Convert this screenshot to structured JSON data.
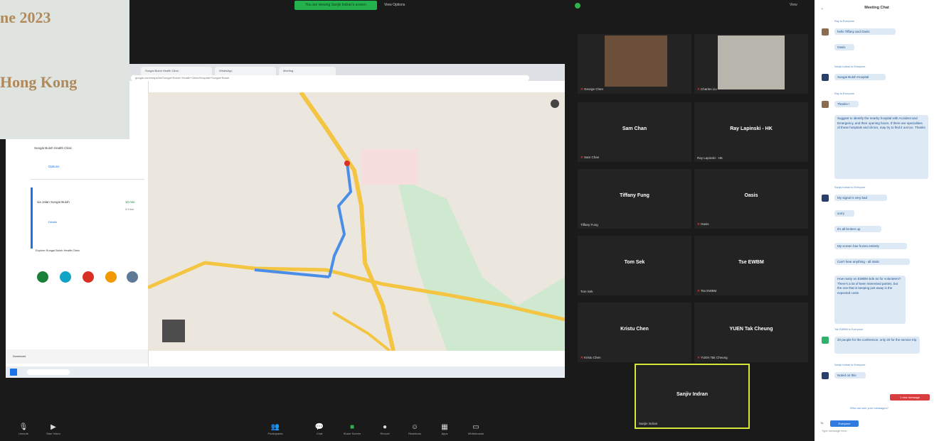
{
  "caption": {
    "line1": "ne 2023",
    "line2": "Hong Kong"
  },
  "top": {
    "share_banner": "You are viewing Sanjiv Indran's screen",
    "view_options": "View Options",
    "view_btn": "View"
  },
  "browser": {
    "tabs": [
      "Sungai Buloh Health Clinic",
      "WhatsApp",
      "Meeting"
    ],
    "url": "google.com/maps/dir/Sungai+Buloh+Health+Clinic/Hospital+Sungai+Buloh"
  },
  "maps_panel": {
    "heading": "Sungai Buloh Health Clinic",
    "options": "Options",
    "route_title": "via Jalan Sungai Buloh",
    "route_time": "10 min",
    "route_dist": "3.9 km",
    "details": "Details",
    "explore": "Explore Sungai Buloh Health Clinic",
    "download": "Download"
  },
  "gallery": [
    {
      "name": "",
      "label": "George Chen"
    },
    {
      "name": "",
      "label": "Charles Liu"
    },
    {
      "name": "Sam Chan",
      "label": "Sam Chan"
    },
    {
      "name": "Ray Lapinski - HK",
      "label": "Ray Lapinski - HK"
    },
    {
      "name": "Tiffany Fung",
      "label": "Tiffany Fung"
    },
    {
      "name": "Oasis",
      "label": "Oasis"
    },
    {
      "name": "Tom Sek",
      "label": "Tom Sek"
    },
    {
      "name": "Tse EWBM",
      "label": "Tse EWBM"
    },
    {
      "name": "Kristu Chen",
      "label": "Kristu Chen"
    },
    {
      "name": "YUEN Tak Cheung",
      "label": "YUEN Tak Cheung"
    }
  ],
  "active_speaker": {
    "name": "Sanjiv Indran",
    "label": "Sanjiv Indran"
  },
  "chat": {
    "title": "Meeting Chat",
    "messages": [
      {
        "meta": "Ray to Everyone",
        "text": "hello Tiffany and Oasis"
      },
      {
        "meta": "",
        "text": "Oasis"
      },
      {
        "meta": "Sanjiv Indran to Everyone",
        "text": "Sungai Buloh Hospital"
      },
      {
        "meta": "Ray to Everyone",
        "text": "Thanks !"
      },
      {
        "meta": "",
        "text": "Suggest to identify the nearby hospital with Accident and Emergency, and their opening hours. If there are specialities of those hospitals and clinics, may try to find it out too. Thanks"
      },
      {
        "meta": "Sanjiv Indran to Everyone",
        "text": "My signal is very bad"
      },
      {
        "meta": "",
        "text": "sorry"
      },
      {
        "meta": "",
        "text": "it's all broken up"
      },
      {
        "meta": "",
        "text": "My screen has frozen entirely"
      },
      {
        "meta": "",
        "text": "Can't hear anything - all static"
      },
      {
        "meta": "",
        "text": "How many on EWBM side as for volunteers? There's a lot of keen interested parties, but the one that is keeping just away is the expected costs"
      },
      {
        "meta": "Tse EWBM to Everyone",
        "text": "20 people for the conference, only 20 for the service trip"
      },
      {
        "meta": "Sanjiv Indran to Everyone",
        "text": "Noted on this"
      }
    ],
    "unread": "1 new message",
    "who_see": "Who can see your messages?",
    "to_label": "To:",
    "to_value": "Everyone",
    "input_placeholder": "Type message here..."
  },
  "toolbar": [
    {
      "icon": "mic-icon",
      "label": "Unmute"
    },
    {
      "icon": "video-icon",
      "label": "Start Video"
    },
    {
      "icon": "participants-icon",
      "label": "Participants"
    },
    {
      "icon": "chat-icon",
      "label": "Chat"
    },
    {
      "icon": "share-icon",
      "label": "Share Screen"
    },
    {
      "icon": "record-icon",
      "label": "Record"
    },
    {
      "icon": "reactions-icon",
      "label": "Reactions"
    },
    {
      "icon": "apps-icon",
      "label": "Apps"
    },
    {
      "icon": "whiteboard-icon",
      "label": "Whiteboards"
    }
  ]
}
